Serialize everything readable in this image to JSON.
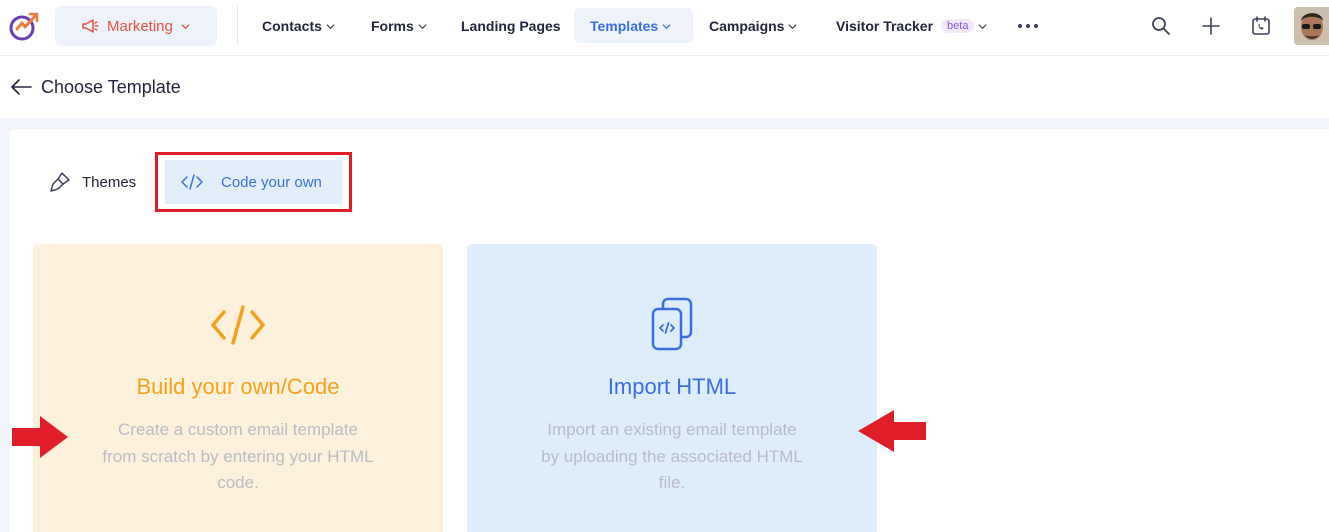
{
  "topbar": {
    "module_label": "Marketing",
    "nav": [
      {
        "label": "Contacts"
      },
      {
        "label": "Forms"
      },
      {
        "label": "Landing Pages"
      },
      {
        "label": "Templates"
      },
      {
        "label": "Campaigns"
      },
      {
        "label": "Visitor Tracker",
        "badge": "beta"
      }
    ],
    "active_nav": "Templates",
    "icons": [
      "search-icon",
      "plus-icon",
      "calendar-phone-icon"
    ]
  },
  "page": {
    "title": "Choose Template"
  },
  "tabs": {
    "themes_label": "Themes",
    "code_label": "Code your own",
    "selected": "Code your own"
  },
  "cards": {
    "build": {
      "title": "Build your own/Code",
      "line1": "Create a custom email template",
      "line2": "from scratch by entering your HTML",
      "line3": "code."
    },
    "import": {
      "title": "Import HTML",
      "line1": "Import an existing email template",
      "line2": "by uploading the associated HTML",
      "line3": "file."
    }
  },
  "colors": {
    "accent": "#3b6fe0",
    "brand_orange": "#f5a21b",
    "annotation_red": "#e01e2a",
    "marketing_red": "#e5533d"
  }
}
